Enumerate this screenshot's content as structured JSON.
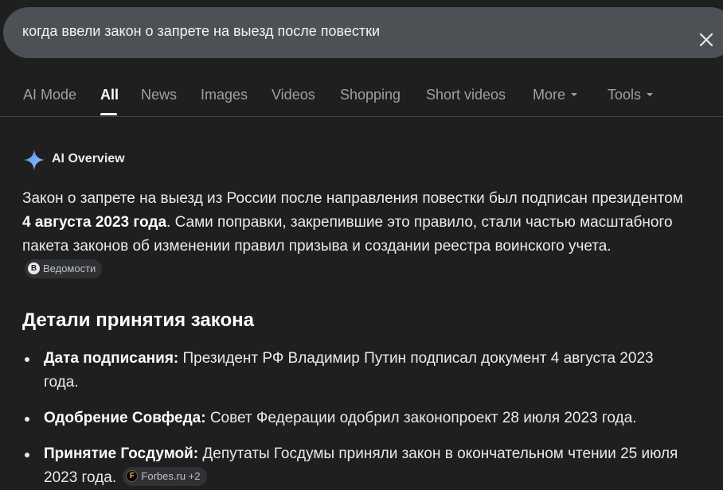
{
  "search": {
    "query": "когда ввели закон о запрете на выезд после повестки"
  },
  "tabs": [
    {
      "label": "AI Mode"
    },
    {
      "label": "All"
    },
    {
      "label": "News"
    },
    {
      "label": "Images"
    },
    {
      "label": "Videos"
    },
    {
      "label": "Shopping"
    },
    {
      "label": "Short videos"
    },
    {
      "label": "More"
    },
    {
      "label": "Tools"
    }
  ],
  "ai_overview": {
    "title": "AI Overview",
    "para_part1": "Закон о запрете на выезд из России после направления повестки был подписан президентом ",
    "para_bold": "4 августа 2023 года",
    "para_part2": ". Сами поправки, закрепившие это правило, стали частью масштабного пакета законов об изменении правил призыва и создании реестра воинского учета.",
    "para_source": "Ведомости",
    "section_heading": "Детали принятия закона",
    "bullets": [
      {
        "label": "Дата подписания:",
        "text": " Президент РФ Владимир Путин подписал документ 4 августа 2023 года."
      },
      {
        "label": "Одобрение Совфеда:",
        "text": " Совет Федерации одобрил законопроект 28 июля 2023 года."
      },
      {
        "label": "Принятие Госдумой:",
        "text": " Депутаты Госдумы приняли закон в окончательном чтении 25 июля 2023 года.",
        "source": "Forbes.ru +2"
      }
    ]
  },
  "colors": {
    "background": "#1f1f1f",
    "search_bar": "#4d5156",
    "chip": "#303134"
  }
}
